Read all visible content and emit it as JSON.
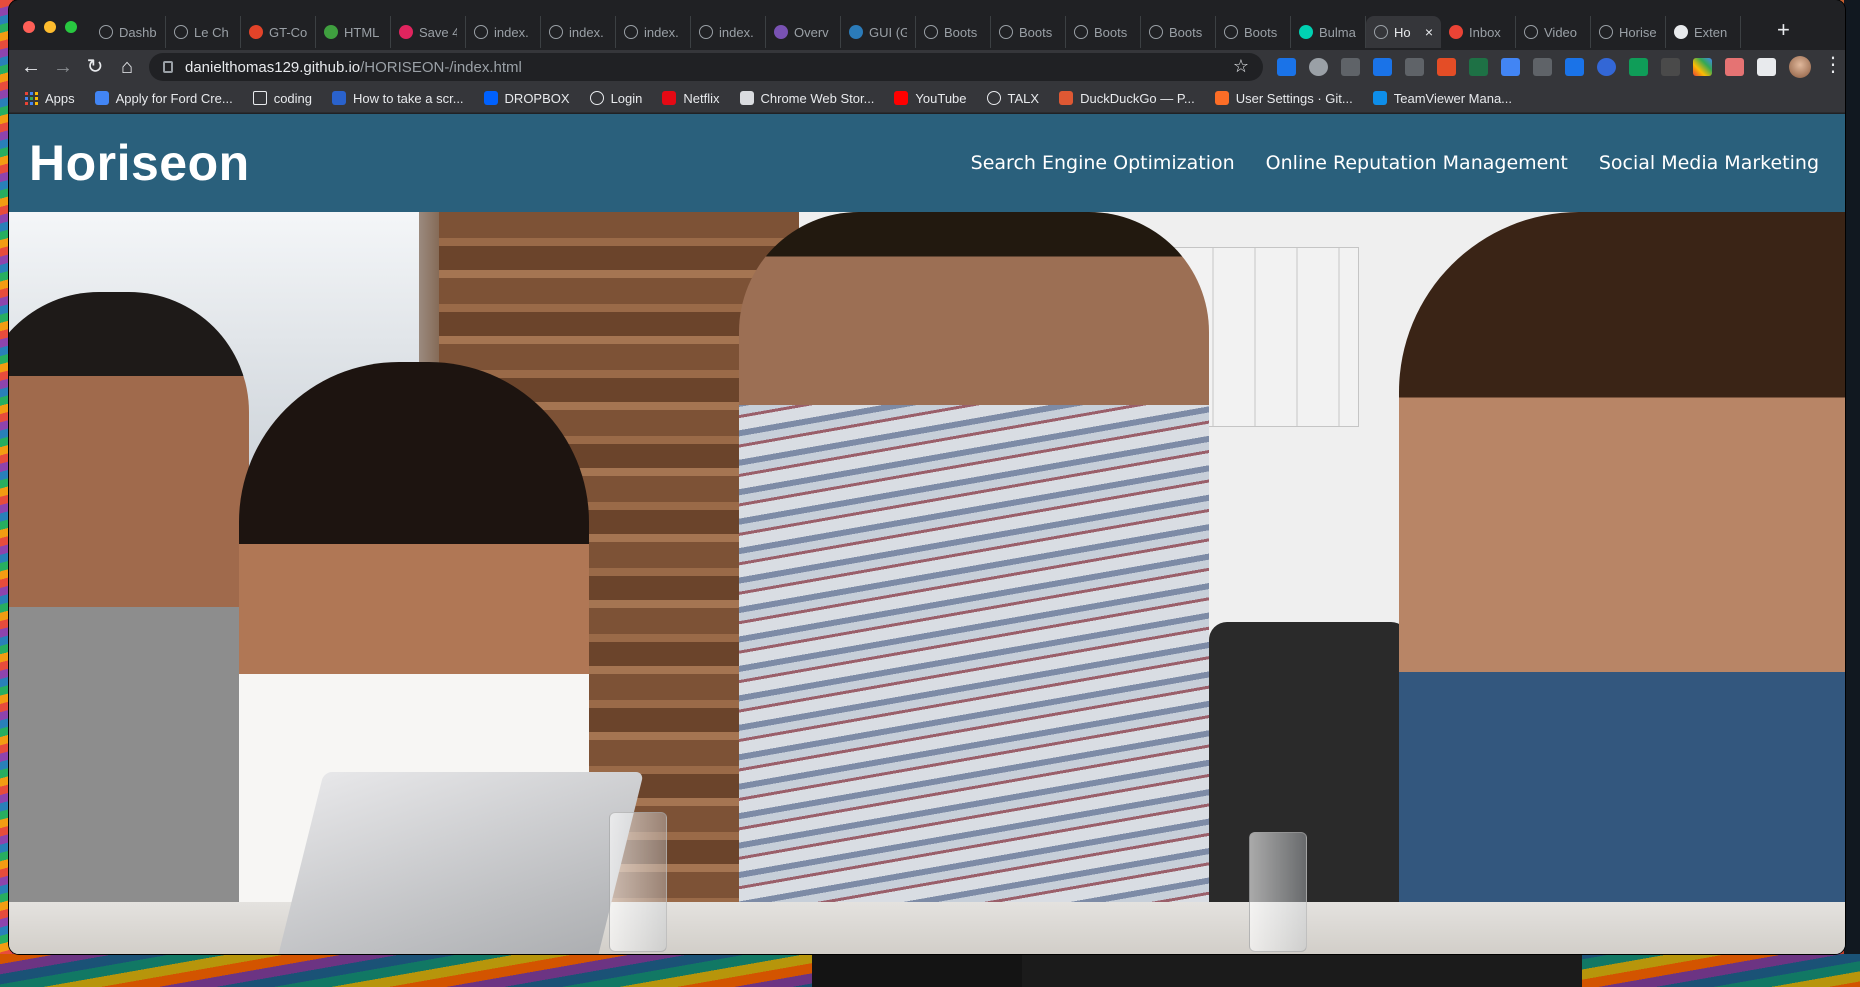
{
  "browser": {
    "tabs": [
      {
        "label": "Dashb",
        "favicon": "globe-icon"
      },
      {
        "label": "Le Ch",
        "favicon": "globe-icon"
      },
      {
        "label": "GT-Co",
        "favicon": "gitlab-icon"
      },
      {
        "label": "HTML",
        "favicon": "html-icon"
      },
      {
        "label": "Save 4",
        "favicon": "save-icon"
      },
      {
        "label": "index.",
        "favicon": "globe-icon"
      },
      {
        "label": "index.",
        "favicon": "globe-icon"
      },
      {
        "label": "index.",
        "favicon": "globe-icon"
      },
      {
        "label": "index.",
        "favicon": "globe-icon"
      },
      {
        "label": "Overv",
        "favicon": "bootstrap-icon"
      },
      {
        "label": "GUI (G",
        "favicon": "book-icon"
      },
      {
        "label": "Boots",
        "favicon": "globe-icon"
      },
      {
        "label": "Boots",
        "favicon": "globe-icon"
      },
      {
        "label": "Boots",
        "favicon": "globe-icon"
      },
      {
        "label": "Boots",
        "favicon": "globe-icon"
      },
      {
        "label": "Boots",
        "favicon": "globe-icon"
      },
      {
        "label": "Bulma",
        "favicon": "bulma-icon"
      },
      {
        "label": "Ho",
        "favicon": "globe-icon",
        "active": true
      },
      {
        "label": "Inbox",
        "favicon": "gmail-icon"
      },
      {
        "label": "Video",
        "favicon": "globe-icon"
      },
      {
        "label": "Horise",
        "favicon": "globe-icon"
      },
      {
        "label": "Exten",
        "favicon": "puzzle-icon"
      }
    ],
    "url_host": "danielthomas129.github.io",
    "url_path": "/HORISEON-/index.html",
    "bookmarks": [
      {
        "label": "Apps"
      },
      {
        "label": "Apply for Ford Cre..."
      },
      {
        "label": "coding"
      },
      {
        "label": "How to take a scr..."
      },
      {
        "label": "DROPBOX"
      },
      {
        "label": "Login"
      },
      {
        "label": "Netflix"
      },
      {
        "label": "Chrome Web Stor..."
      },
      {
        "label": "YouTube"
      },
      {
        "label": "TALX"
      },
      {
        "label": "DuckDuckGo — P..."
      },
      {
        "label": "User Settings · Git..."
      },
      {
        "label": "TeamViewer Mana..."
      }
    ]
  },
  "site": {
    "logo": "Horiseon",
    "nav": [
      {
        "label": "Search Engine Optimization"
      },
      {
        "label": "Online Reputation Management"
      },
      {
        "label": "Social Media Marketing"
      }
    ],
    "header_color": "#2a607c"
  }
}
